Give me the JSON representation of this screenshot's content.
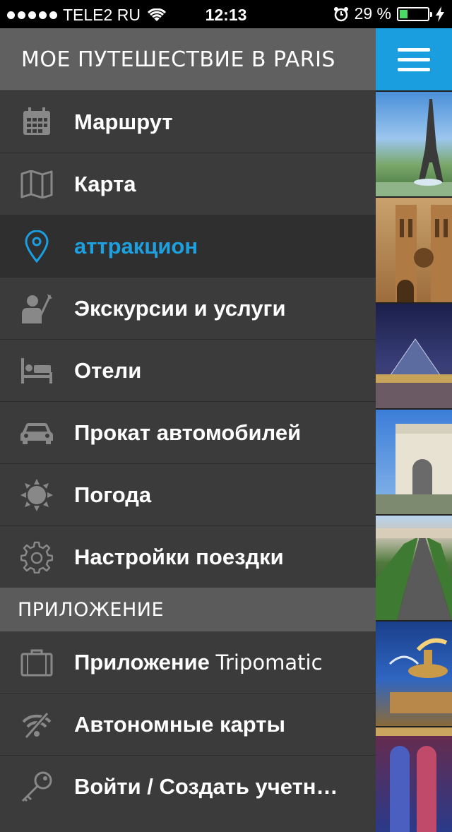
{
  "status": {
    "carrier": "TELE2 RU",
    "time": "12:13",
    "battery_percent": "29 %",
    "battery_level": 0.29
  },
  "header": {
    "title": "МОЕ ПУТЕШЕСТВИЕ В PARIS"
  },
  "menu": [
    {
      "label": "Маршрут",
      "icon": "calendar-icon"
    },
    {
      "label": "Карта",
      "icon": "map-icon"
    },
    {
      "label": "аттракцион",
      "icon": "location-pin-icon",
      "active": true
    },
    {
      "label": "Экскурсии и услуги",
      "icon": "tour-guide-icon"
    },
    {
      "label": "Отели",
      "icon": "bed-icon"
    },
    {
      "label": "Прокат автомобилей",
      "icon": "car-icon"
    },
    {
      "label": "Погода",
      "icon": "sun-icon"
    },
    {
      "label": "Настройки поездки",
      "icon": "gear-icon"
    }
  ],
  "section": {
    "title": "ПРИЛОЖЕНИЕ"
  },
  "app_items": [
    {
      "label_bold": "Приложение",
      "label_light": "Tripomatic",
      "icon": "suitcase-icon"
    },
    {
      "label": "Автономные карты",
      "icon": "offline-signal-icon"
    },
    {
      "label": "Войти / Создать учетн…",
      "icon": "key-icon"
    }
  ],
  "accent": "#1a9ee0"
}
